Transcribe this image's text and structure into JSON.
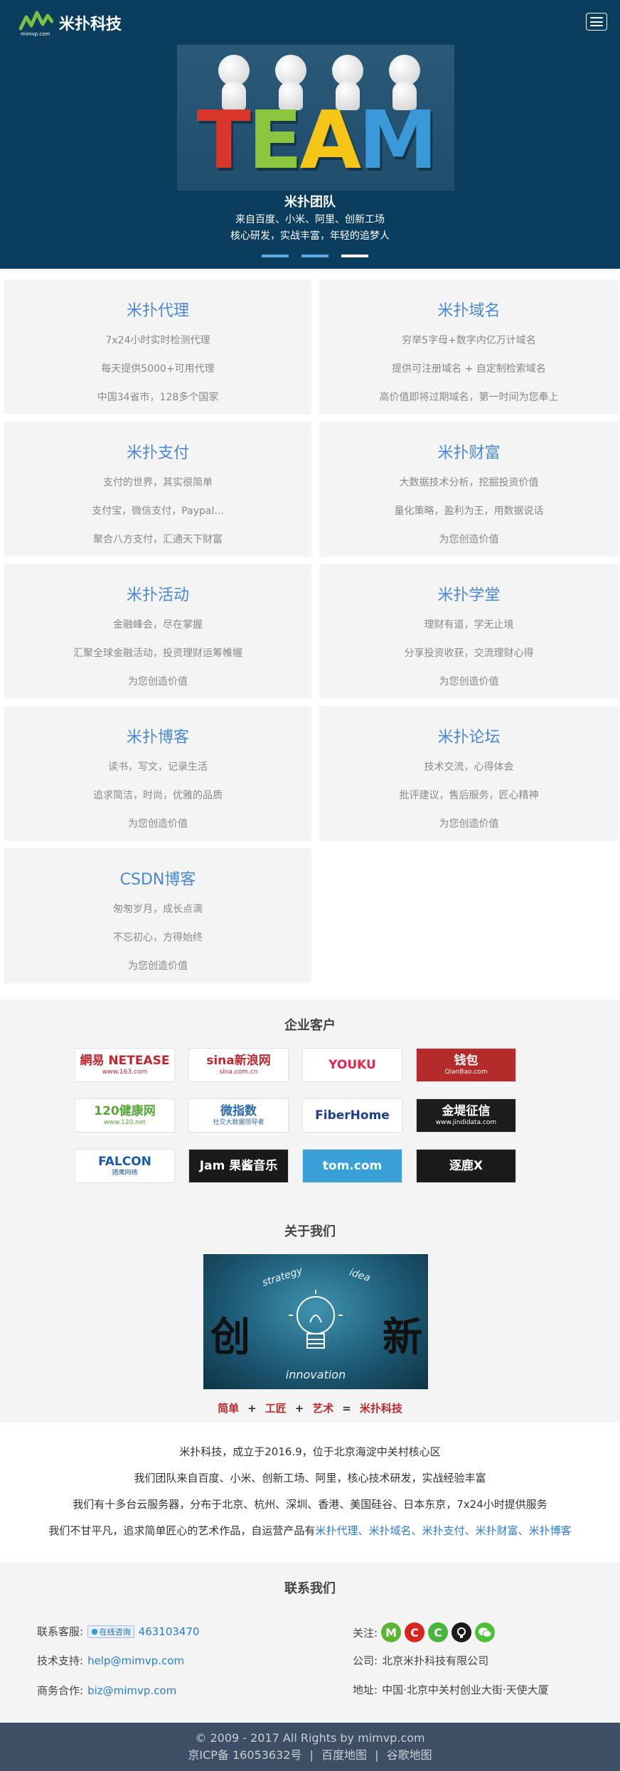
{
  "header": {
    "brand": "米扑科技",
    "brand_sub": "mimvp.com",
    "banner": {
      "word": "TEAM",
      "title": "米扑团队",
      "line1": "来自百度、小米、阿里、创新工场",
      "line2": "核心研发，实战丰富，年轻的追梦人"
    }
  },
  "services": [
    {
      "title": "米扑代理",
      "lines": [
        "7x24小时实时检测代理",
        "每天提供5000+可用代理",
        "中国34省市，128多个国家"
      ]
    },
    {
      "title": "米扑域名",
      "lines": [
        "穷举5字母+数字内亿万计域名",
        "提供可注册域名 + 自定制检索域名",
        "高价值即将过期域名，第一时间为您奉上"
      ]
    },
    {
      "title": "米扑支付",
      "lines": [
        "支付的世界，其实很简单",
        "支付宝，微信支付，Paypal...",
        "聚合八方支付，汇通天下财富"
      ]
    },
    {
      "title": "米扑财富",
      "lines": [
        "大数据技术分析，挖掘投资价值",
        "量化策略，盈利为王，用数据说话",
        "为您创造价值"
      ]
    },
    {
      "title": "米扑活动",
      "lines": [
        "金融峰会，尽在掌握",
        "汇聚全球金融活动，投资理财运筹帷幄",
        "为您创造价值"
      ]
    },
    {
      "title": "米扑学堂",
      "lines": [
        "理财有道，学无止境",
        "分享投资收获，交流理财心得",
        "为您创造价值"
      ]
    },
    {
      "title": "米扑博客",
      "lines": [
        "读书，写文，记录生活",
        "追求简洁，时尚，优雅的品质",
        "为您创造价值"
      ]
    },
    {
      "title": "米扑论坛",
      "lines": [
        "技术交流，心得体会",
        "批评建议，售后服务，匠心精神",
        "为您创造价值"
      ]
    },
    {
      "title": "CSDN博客",
      "lines": [
        "匆匆岁月，成长点滴",
        "不忘初心，方得始终",
        "为您创造价值"
      ]
    }
  ],
  "clients": {
    "title": "企业客户",
    "logos": [
      {
        "text": "網易 NETEASE",
        "sub": "www.163.com",
        "color": "#c0282d",
        "bg": "#ffffff"
      },
      {
        "text": "sina新浪网",
        "sub": "sina.com.cn",
        "color": "#c0282d",
        "bg": "#ffffff"
      },
      {
        "text": "YOUKU",
        "sub": "",
        "color": "#e6264b",
        "bg": "#ffffff"
      },
      {
        "text": "钱包",
        "sub": "QianBao.com",
        "color": "#ffffff",
        "bg": "#b52a2a"
      },
      {
        "text": "120健康网",
        "sub": "www.120.net",
        "color": "#58a63a",
        "bg": "#ffffff"
      },
      {
        "text": "微指数",
        "sub": "社交大数据领导者",
        "color": "#2a6ab0",
        "bg": "#ffffff"
      },
      {
        "text": "FiberHome",
        "sub": "",
        "color": "#1d3e8a",
        "bg": "#ffffff"
      },
      {
        "text": "金堤征信",
        "sub": "www.jindidata.com",
        "color": "#ffffff",
        "bg": "#1c1c1c"
      },
      {
        "text": "FALCON",
        "sub": "猎鹰网络",
        "color": "#1d5aa8",
        "bg": "#ffffff"
      },
      {
        "text": "Jam 果酱音乐",
        "sub": "",
        "color": "#ffffff",
        "bg": "#1a1a1a"
      },
      {
        "text": "tom.com",
        "sub": "",
        "color": "#ffffff",
        "bg": "#3aa0d8"
      },
      {
        "text": "逐鹿X",
        "sub": "",
        "color": "#ffffff",
        "bg": "#1a1a1a"
      }
    ]
  },
  "about": {
    "title": "关于我们",
    "img_words": {
      "left": "创",
      "right": "新",
      "top1": "strategy",
      "top2": "idea",
      "bottom": "innovation"
    },
    "formula": {
      "a": "简单",
      "plus1": "+",
      "b": "工匠",
      "plus2": "+",
      "c": "艺术",
      "eq": "=",
      "d": "米扑科技"
    },
    "p1": "米扑科技，成立于2016.9，位于北京海淀中关村核心区",
    "p2": "我们团队来自百度、小米、创新工场、阿里，核心技术研发，实战经验丰富",
    "p3": "我们有十多台云服务器，分布于北京、杭州、深圳、香港、美国硅谷、日本东京，7x24小时提供服务",
    "p4_prefix": "我们不甘平凡，追求简单匠心的艺术作品，自运营产品有",
    "p4_links": [
      "米扑代理",
      "米扑域名",
      "米扑支付",
      "米扑财富",
      "米扑博客"
    ],
    "p4_sep": "、"
  },
  "contact": {
    "title": "联系我们",
    "service_label": "联系客服:",
    "service_badge": "在线咨询",
    "service_qq": "463103470",
    "tech_label": "技术支持:",
    "tech_email": "help@mimvp.com",
    "biz_label": "商务合作:",
    "biz_email": "biz@mimvp.com",
    "follow_label": "关注:",
    "social": [
      {
        "name": "M",
        "color": "#5bb531"
      },
      {
        "name": "C",
        "color": "#d9241f"
      },
      {
        "name": "C",
        "color": "#4bb43a"
      },
      {
        "name": "",
        "color": "#1a1a1a"
      },
      {
        "name": "",
        "color": "#4fc03a"
      }
    ],
    "company_label": "公司:",
    "company": "北京米扑科技有限公司",
    "address_label": "地址:",
    "address": "中国·北京中关村创业大街·天使大厦"
  },
  "footer": {
    "copyright": "© 2009 - 2017 All Rights by mimvp.com",
    "icp": "京ICP备 16053632号",
    "sep": "|",
    "link1": "百度地图",
    "link2": "谷歌地图"
  }
}
